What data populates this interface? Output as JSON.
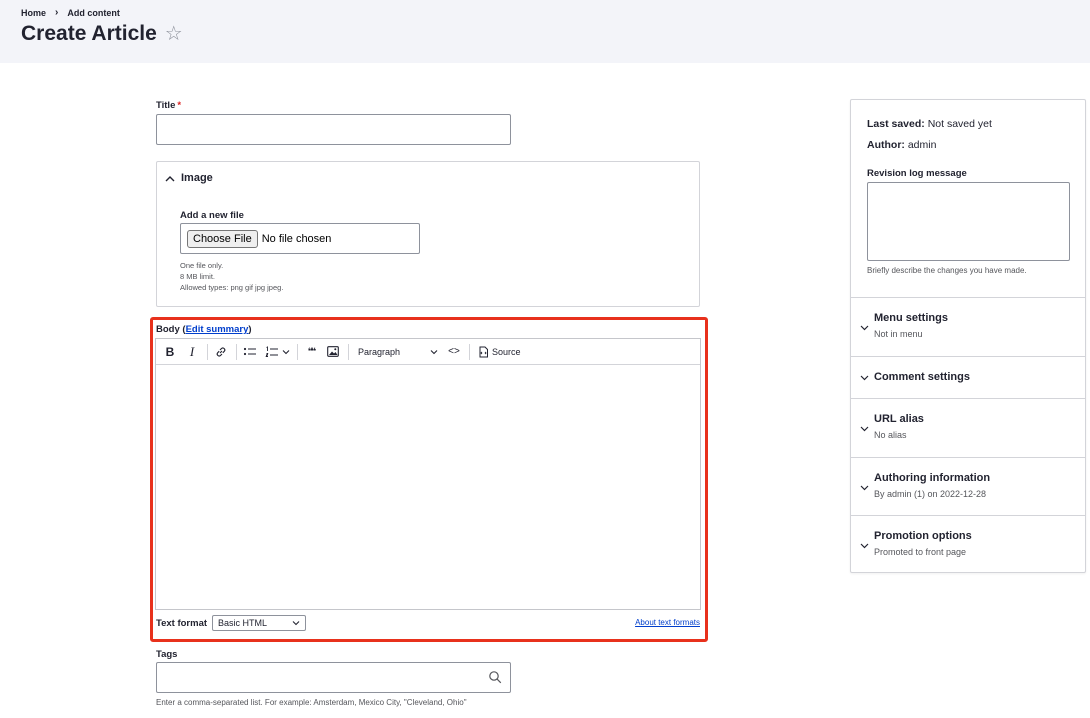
{
  "breadcrumb": {
    "home": "Home",
    "separator": "›",
    "current": "Add content"
  },
  "page": {
    "title": "Create Article",
    "star": "☆"
  },
  "title_field": {
    "label": "Title",
    "required_mark": "*",
    "value": ""
  },
  "image": {
    "summary": "Image",
    "add_label": "Add a new file",
    "choose_button": "Choose File",
    "no_file": "No file chosen",
    "help_lines": [
      "One file only.",
      "8 MB limit.",
      "Allowed types: png gif jpg jpeg."
    ]
  },
  "body": {
    "label": "Body",
    "edit_summary": "Edit summary",
    "toolbar": {
      "bold": "B",
      "italic": "I",
      "paragraph": "Paragraph",
      "code": "<>",
      "source": "Source",
      "quote": "❝❝"
    },
    "text_format_label": "Text format",
    "text_format_value": "Basic HTML",
    "about_link": "About text formats"
  },
  "tags": {
    "label": "Tags",
    "help": "Enter a comma-separated list. For example: Amsterdam, Mexico City, \"Cleveland, Ohio\""
  },
  "sidebar": {
    "last_saved_label": "Last saved:",
    "last_saved_value": "Not saved yet",
    "author_label": "Author:",
    "author_value": "admin",
    "revision_label": "Revision log message",
    "revision_help": "Briefly describe the changes you have made.",
    "sections": [
      {
        "title": "Menu settings",
        "subtitle": "Not in menu"
      },
      {
        "title": "Comment settings",
        "subtitle": ""
      },
      {
        "title": "URL alias",
        "subtitle": "No alias"
      },
      {
        "title": "Authoring information",
        "subtitle": "By admin (1) on 2022-12-28"
      },
      {
        "title": "Promotion options",
        "subtitle": "Promoted to front page"
      }
    ]
  },
  "colors": {
    "highlight": "#e8311c",
    "link": "#003ecc",
    "header_bg": "#f3f4f9",
    "required": "#dc2323"
  }
}
